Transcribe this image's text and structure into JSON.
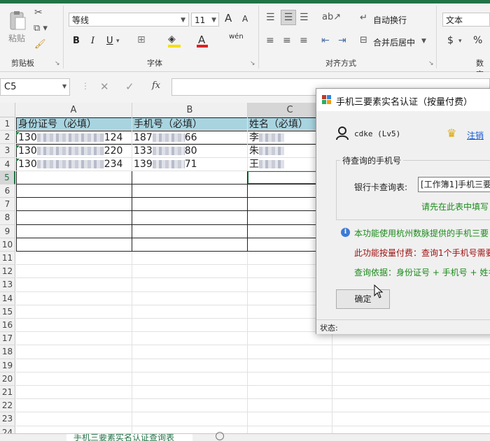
{
  "ribbon": {
    "clipboard": {
      "paste_label": "粘贴",
      "group_label": "剪贴板"
    },
    "font": {
      "font_name": "等线",
      "font_size": "11",
      "group_label": "字体",
      "bold": "B",
      "italic": "I",
      "underline": "U",
      "grow": "A",
      "shrink": "A",
      "wen": "wén"
    },
    "alignment": {
      "wrap_text": "自动换行",
      "merge_center": "合并后居中",
      "group_label": "对齐方式"
    },
    "number": {
      "format": "文本",
      "currency": "$",
      "percent": "%",
      "group_label": "数字"
    }
  },
  "formula_bar": {
    "name_box": "C5",
    "fx": "fx"
  },
  "sheet": {
    "columns": [
      "A",
      "B",
      "C"
    ],
    "rows": [
      "1",
      "2",
      "3",
      "4",
      "5",
      "6",
      "7",
      "8",
      "9",
      "10",
      "11",
      "12",
      "13",
      "14",
      "15",
      "16",
      "17",
      "18",
      "19",
      "20",
      "21",
      "22",
      "23",
      "24"
    ],
    "header": {
      "a": "身份证号（必填）",
      "b": "手机号（必填）",
      "c": "姓名（必填）"
    },
    "data": [
      {
        "a_prefix": "130",
        "a_suffix": "124",
        "b_prefix": "187",
        "b_suffix": "66",
        "c": "李"
      },
      {
        "a_prefix": "130",
        "a_suffix": "220",
        "b_prefix": "133",
        "b_suffix": "80",
        "c": "朱"
      },
      {
        "a_prefix": "130",
        "a_suffix": "234",
        "b_prefix": "139",
        "b_suffix": "71",
        "c": "王"
      }
    ]
  },
  "dialog": {
    "title": "手机三要素实名认证（按量付费）",
    "user": "cdke (Lv5)",
    "logout": "注销",
    "section_title": "待查询的手机号",
    "field_label": "银行卡查询表:",
    "field_value": "[工作簿1]手机三要",
    "hint": "请先在此表中填写",
    "info1": "本功能使用杭州数脉提供的手机三要",
    "info2": "此功能按量付费：查询1个手机号需要",
    "info3": "查询依据：身份证号 + 手机号 + 姓名",
    "ok_button": "确定",
    "status_label": "状态:"
  },
  "sheet_tab": {
    "label": "手机三要素实名认证查询表"
  },
  "colors": {
    "excel_green": "#217346",
    "header_fill": "#a8d4e0",
    "info_green": "#1a8a1a",
    "info_red": "#a01010"
  }
}
